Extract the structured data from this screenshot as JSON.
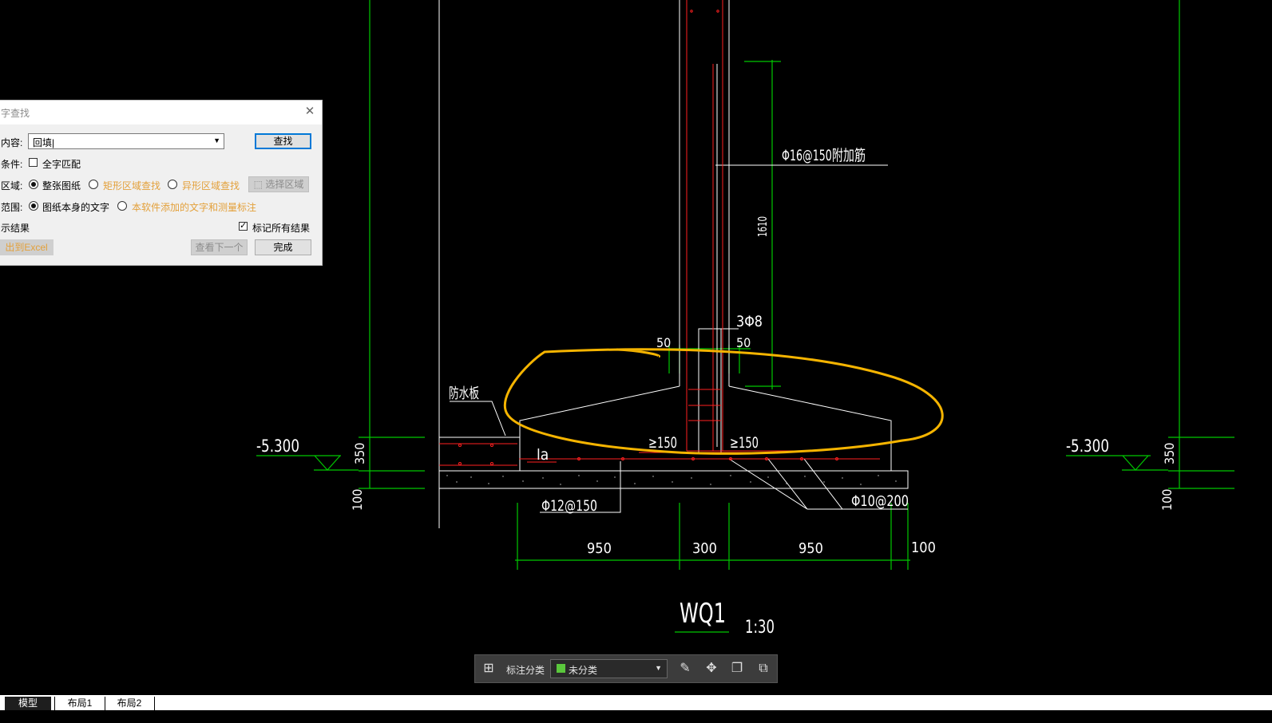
{
  "dialog": {
    "title": "字查找",
    "content_label": "内容:",
    "content_value": "回填|",
    "find_button": "查找",
    "condition_label": "条件:",
    "whole_word": "全字匹配",
    "region_label": "区域:",
    "region_opt1": "整张图纸",
    "region_opt2": "矩形区域查找",
    "region_opt3": "异形区域查找",
    "select_region_button": "选择区域",
    "scope_label": "范围:",
    "scope_opt1": "图纸本身的文字",
    "scope_opt2": "本软件添加的文字和测量标注",
    "show_results": "示结果",
    "mark_all": "标记所有结果",
    "export_button": "出到Excel",
    "next_button": "查看下一个",
    "done_button": "完成"
  },
  "drawing": {
    "annotations": {
      "rebar_top": "Φ16@150附加筋",
      "height_1610": "1610",
      "stirrup": "3Φ8",
      "dim_50_left": "50",
      "dim_50_right": "50",
      "waterproof": "防水板",
      "ge150_left": "≥150",
      "ge150_right": "≥150",
      "la": "la",
      "level_left": "-5.300",
      "level_right": "-5.300",
      "dim_350_left": "350",
      "dim_350_right": "350",
      "dim_100_left": "100",
      "dim_100_right": "100",
      "rebar_bottom_left": "Φ12@150",
      "rebar_bottom_right": "Φ10@200",
      "dim_950_left": "950",
      "dim_300": "300",
      "dim_950_right": "950",
      "dim_100_bottom": "100",
      "title": "WQ1",
      "scale": "1:30"
    },
    "colors": {
      "green": "#00c800",
      "red": "#ff2020",
      "white": "#ffffff",
      "highlight": "#f5b400"
    }
  },
  "toolbar": {
    "label": "标注分类",
    "category": "未分类",
    "icons": [
      "grid-icon",
      "edit-icon",
      "move-icon",
      "copy-icon",
      "paste-icon"
    ]
  },
  "tabs": [
    "模型",
    "布局1",
    "布局2"
  ]
}
